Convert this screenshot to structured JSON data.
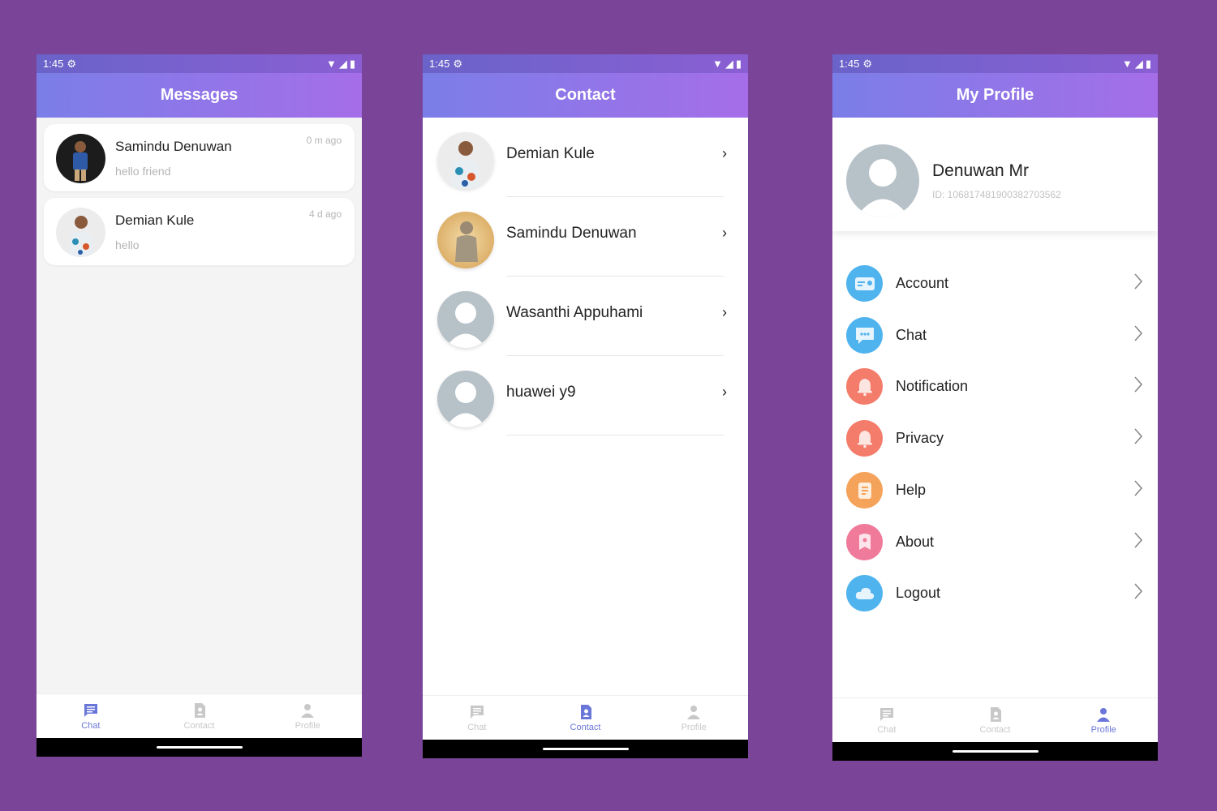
{
  "status": {
    "time": "1:45"
  },
  "messages_screen": {
    "title": "Messages",
    "items": [
      {
        "name": "Samindu Denuwan",
        "preview": "hello friend",
        "time": "0 m ago"
      },
      {
        "name": "Demian Kule",
        "preview": "hello",
        "time": "4 d ago"
      }
    ],
    "nav": {
      "chat": "Chat",
      "contact": "Contact",
      "profile": "Profile",
      "active": "chat"
    }
  },
  "contact_screen": {
    "title": "Contact",
    "items": [
      {
        "name": "Demian Kule"
      },
      {
        "name": "Samindu Denuwan"
      },
      {
        "name": "Wasanthi Appuhami"
      },
      {
        "name": "huawei y9"
      }
    ],
    "nav": {
      "chat": "Chat",
      "contact": "Contact",
      "profile": "Profile",
      "active": "contact"
    }
  },
  "profile_screen": {
    "title": "My Profile",
    "user": {
      "name": "Denuwan Mr",
      "id": "ID: 106817481900382703562"
    },
    "menu": [
      {
        "label": "Account",
        "icon": "account-card-icon",
        "color": "#4fb3ee"
      },
      {
        "label": "Chat",
        "icon": "chat-bubble-icon",
        "color": "#4fb3ee"
      },
      {
        "label": "Notification",
        "icon": "bell-icon",
        "color": "#f47c6b"
      },
      {
        "label": "Privacy",
        "icon": "bell-icon",
        "color": "#f47c6b"
      },
      {
        "label": "Help",
        "icon": "help-document-icon",
        "color": "#f5a35b"
      },
      {
        "label": "About",
        "icon": "about-icon",
        "color": "#f07a9a"
      },
      {
        "label": "Logout",
        "icon": "cloud-icon",
        "color": "#4fb3ee"
      }
    ],
    "nav": {
      "chat": "Chat",
      "contact": "Contact",
      "profile": "Profile",
      "active": "profile"
    }
  },
  "colors": {
    "background": "#7a4599",
    "appbar_start": "#7b7ee8",
    "appbar_end": "#a56ee8",
    "nav_active": "#6a77d8",
    "nav_inactive": "#c8c8c8"
  }
}
